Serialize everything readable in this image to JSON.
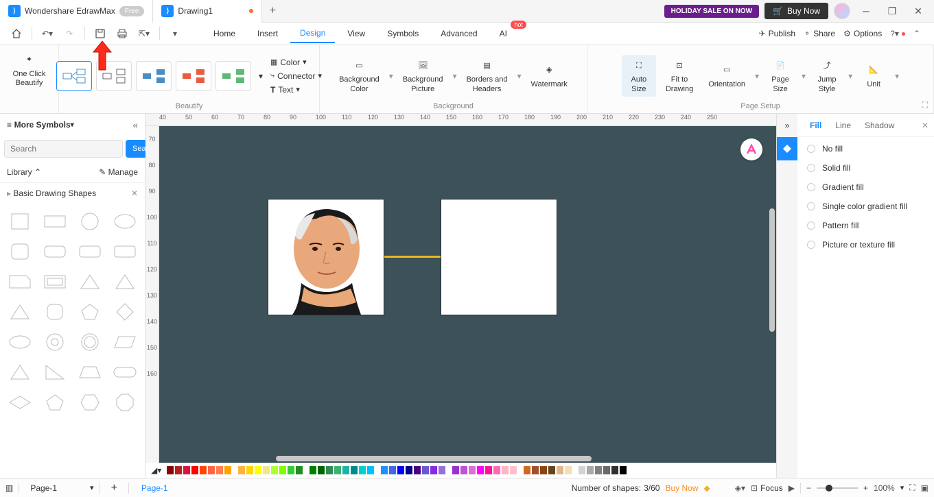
{
  "title": {
    "app": "Wondershare EdrawMax",
    "badge": "Free",
    "doc": "Drawing1",
    "holiday": "HOLIDAY SALE ON NOW",
    "buy": "Buy Now"
  },
  "menu": {
    "items": [
      "Home",
      "Insert",
      "Design",
      "View",
      "Symbols",
      "Advanced",
      "AI"
    ],
    "active": "Design",
    "hot": "hot",
    "publish": "Publish",
    "share": "Share",
    "options": "Options"
  },
  "ribbon": {
    "oneclick": "One Click\nBeautify",
    "beautify": "Beautify",
    "color": "Color",
    "connector": "Connector",
    "text": "Text",
    "bgcolor": "Background\nColor",
    "bgpic": "Background\nPicture",
    "borders": "Borders and\nHeaders",
    "watermark": "Watermark",
    "background": "Background",
    "autosize": "Auto\nSize",
    "fit": "Fit to\nDrawing",
    "orientation": "Orientation",
    "pagesize": "Page\nSize",
    "jump": "Jump\nStyle",
    "unit": "Unit",
    "pagesetup": "Page Setup"
  },
  "left": {
    "more": "More Symbols",
    "search_ph": "Search",
    "search_btn": "Search",
    "library": "Library",
    "manage": "Manage",
    "category": "Basic Drawing Shapes"
  },
  "ruler_h": [
    "40",
    "50",
    "60",
    "70",
    "80",
    "90",
    "100",
    "110",
    "120",
    "130",
    "140",
    "150",
    "160",
    "170",
    "180",
    "190",
    "200",
    "210",
    "220",
    "230",
    "240",
    "250"
  ],
  "ruler_v": [
    "70",
    "80",
    "90",
    "100",
    "110",
    "120",
    "130",
    "140",
    "150",
    "160"
  ],
  "right": {
    "tabs": [
      "Fill",
      "Line",
      "Shadow"
    ],
    "opts": [
      "No fill",
      "Solid fill",
      "Gradient fill",
      "Single color gradient fill",
      "Pattern fill",
      "Picture or texture fill"
    ]
  },
  "status": {
    "page": "Page-1",
    "shapes_label": "Number of shapes:",
    "shapes": "3/60",
    "buy": "Buy Now",
    "focus": "Focus",
    "zoom": "100%"
  }
}
